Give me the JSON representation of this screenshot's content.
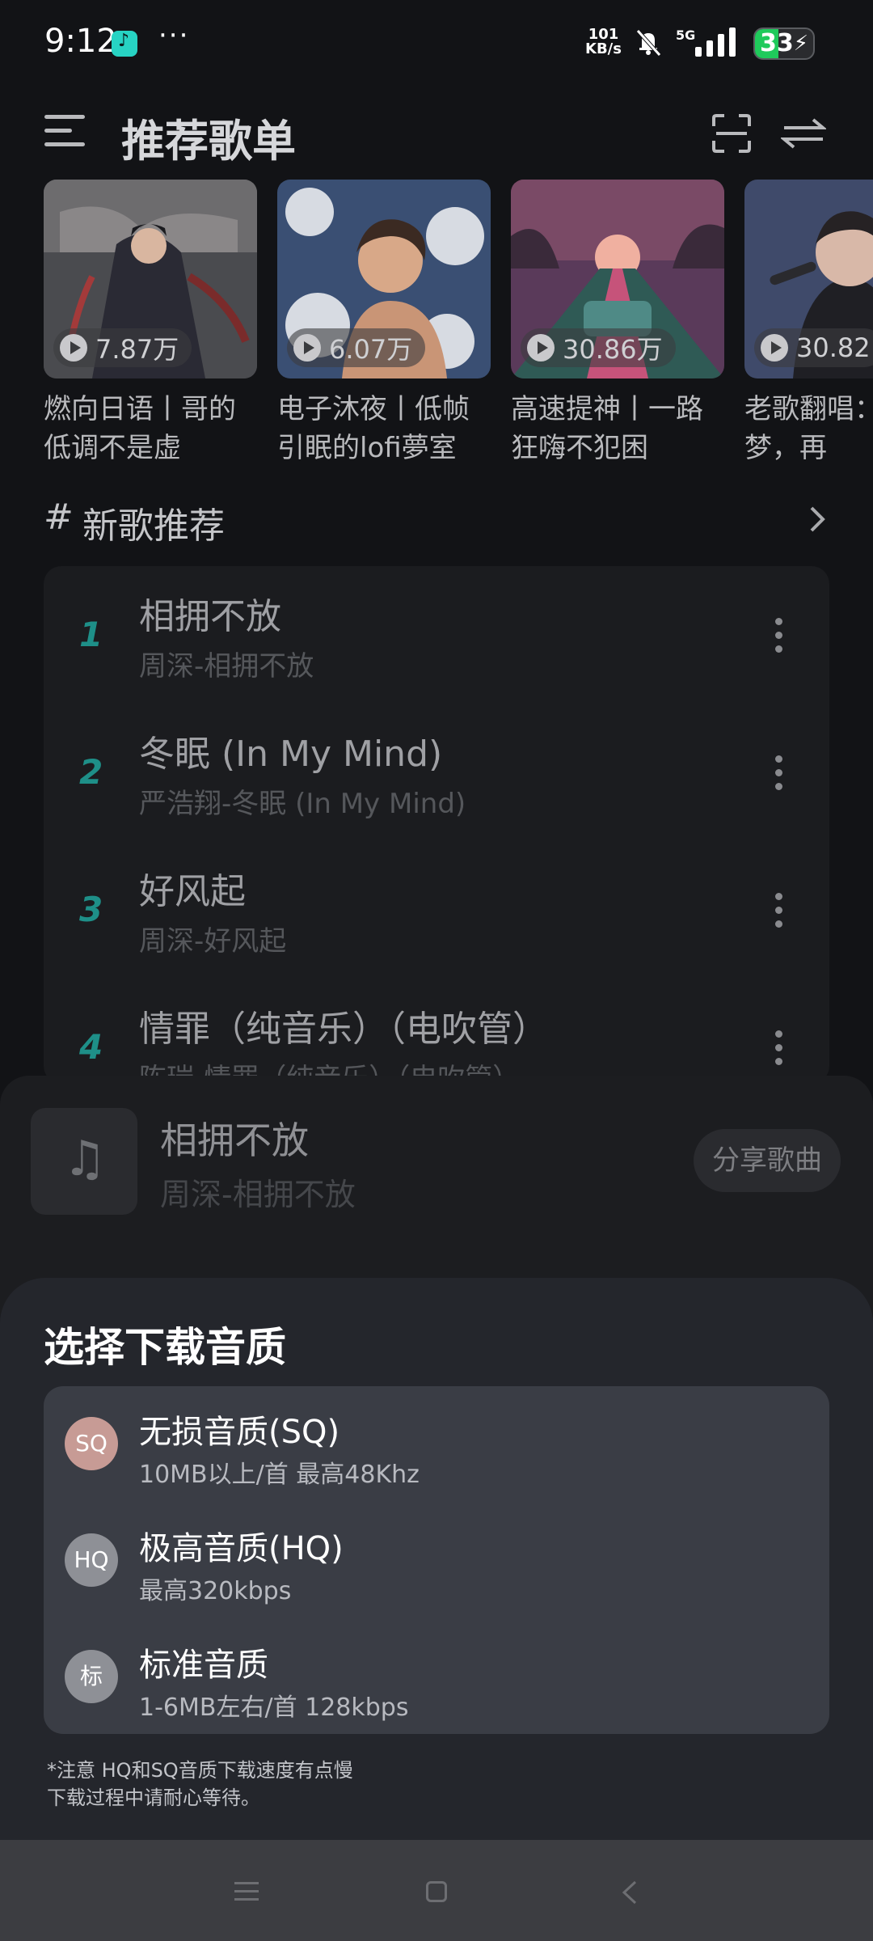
{
  "status_bar": {
    "time": "9:12",
    "dots": "···",
    "speed_value": "101",
    "speed_unit": "KB/s",
    "network": "5G",
    "battery": "33"
  },
  "header": {
    "title": "推荐歌单"
  },
  "playlists": [
    {
      "count": "7.87万",
      "title": "燃向日语丨哥的低调不是虚"
    },
    {
      "count": "6.07万",
      "title": "电子沐夜丨低帧引眠的lofi夢室"
    },
    {
      "count": "30.86万",
      "title": "高速提神丨一路狂嗨不犯困"
    },
    {
      "count": "30.82",
      "title": "老歌翻唱：旧时梦，再"
    }
  ],
  "new_songs": {
    "hash": "#",
    "title": "新歌推荐",
    "items": [
      {
        "rank": "1",
        "name": "相拥不放",
        "artist": "周深-相拥不放"
      },
      {
        "rank": "2",
        "name": "冬眠 (In My Mind)",
        "artist": "严浩翔-冬眠 (In My Mind)"
      },
      {
        "rank": "3",
        "name": "好风起",
        "artist": "周深-好风起"
      },
      {
        "rank": "4",
        "name": "情罪（纯音乐）（电吹管）",
        "artist": "陈瑞-情罪（纯音乐）（电吹管）"
      }
    ]
  },
  "action_sheet": {
    "song_name": "相拥不放",
    "song_artist": "周深-相拥不放",
    "share_label": "分享歌曲"
  },
  "quality_sheet": {
    "title": "选择下载音质",
    "options": [
      {
        "badge": "SQ",
        "name": "无损音质(SQ)",
        "desc": "10MB以上/首 最高48Khz",
        "badge_color": "#c79b95"
      },
      {
        "badge": "HQ",
        "name": "极高音质(HQ)",
        "desc": "最高320kbps",
        "badge_color": "#8e9096"
      },
      {
        "badge": "标",
        "name": "标准音质",
        "desc": "1-6MB左右/首 128kbps",
        "badge_color": "#8e9096"
      }
    ],
    "note_line1": "*注意 HQ和SQ音质下载速度有点慢",
    "note_line2": "下载过程中请耐心等待。"
  },
  "colors": {
    "accent": "#1e8f88",
    "background": "#121316",
    "sheet": "#24262c"
  }
}
